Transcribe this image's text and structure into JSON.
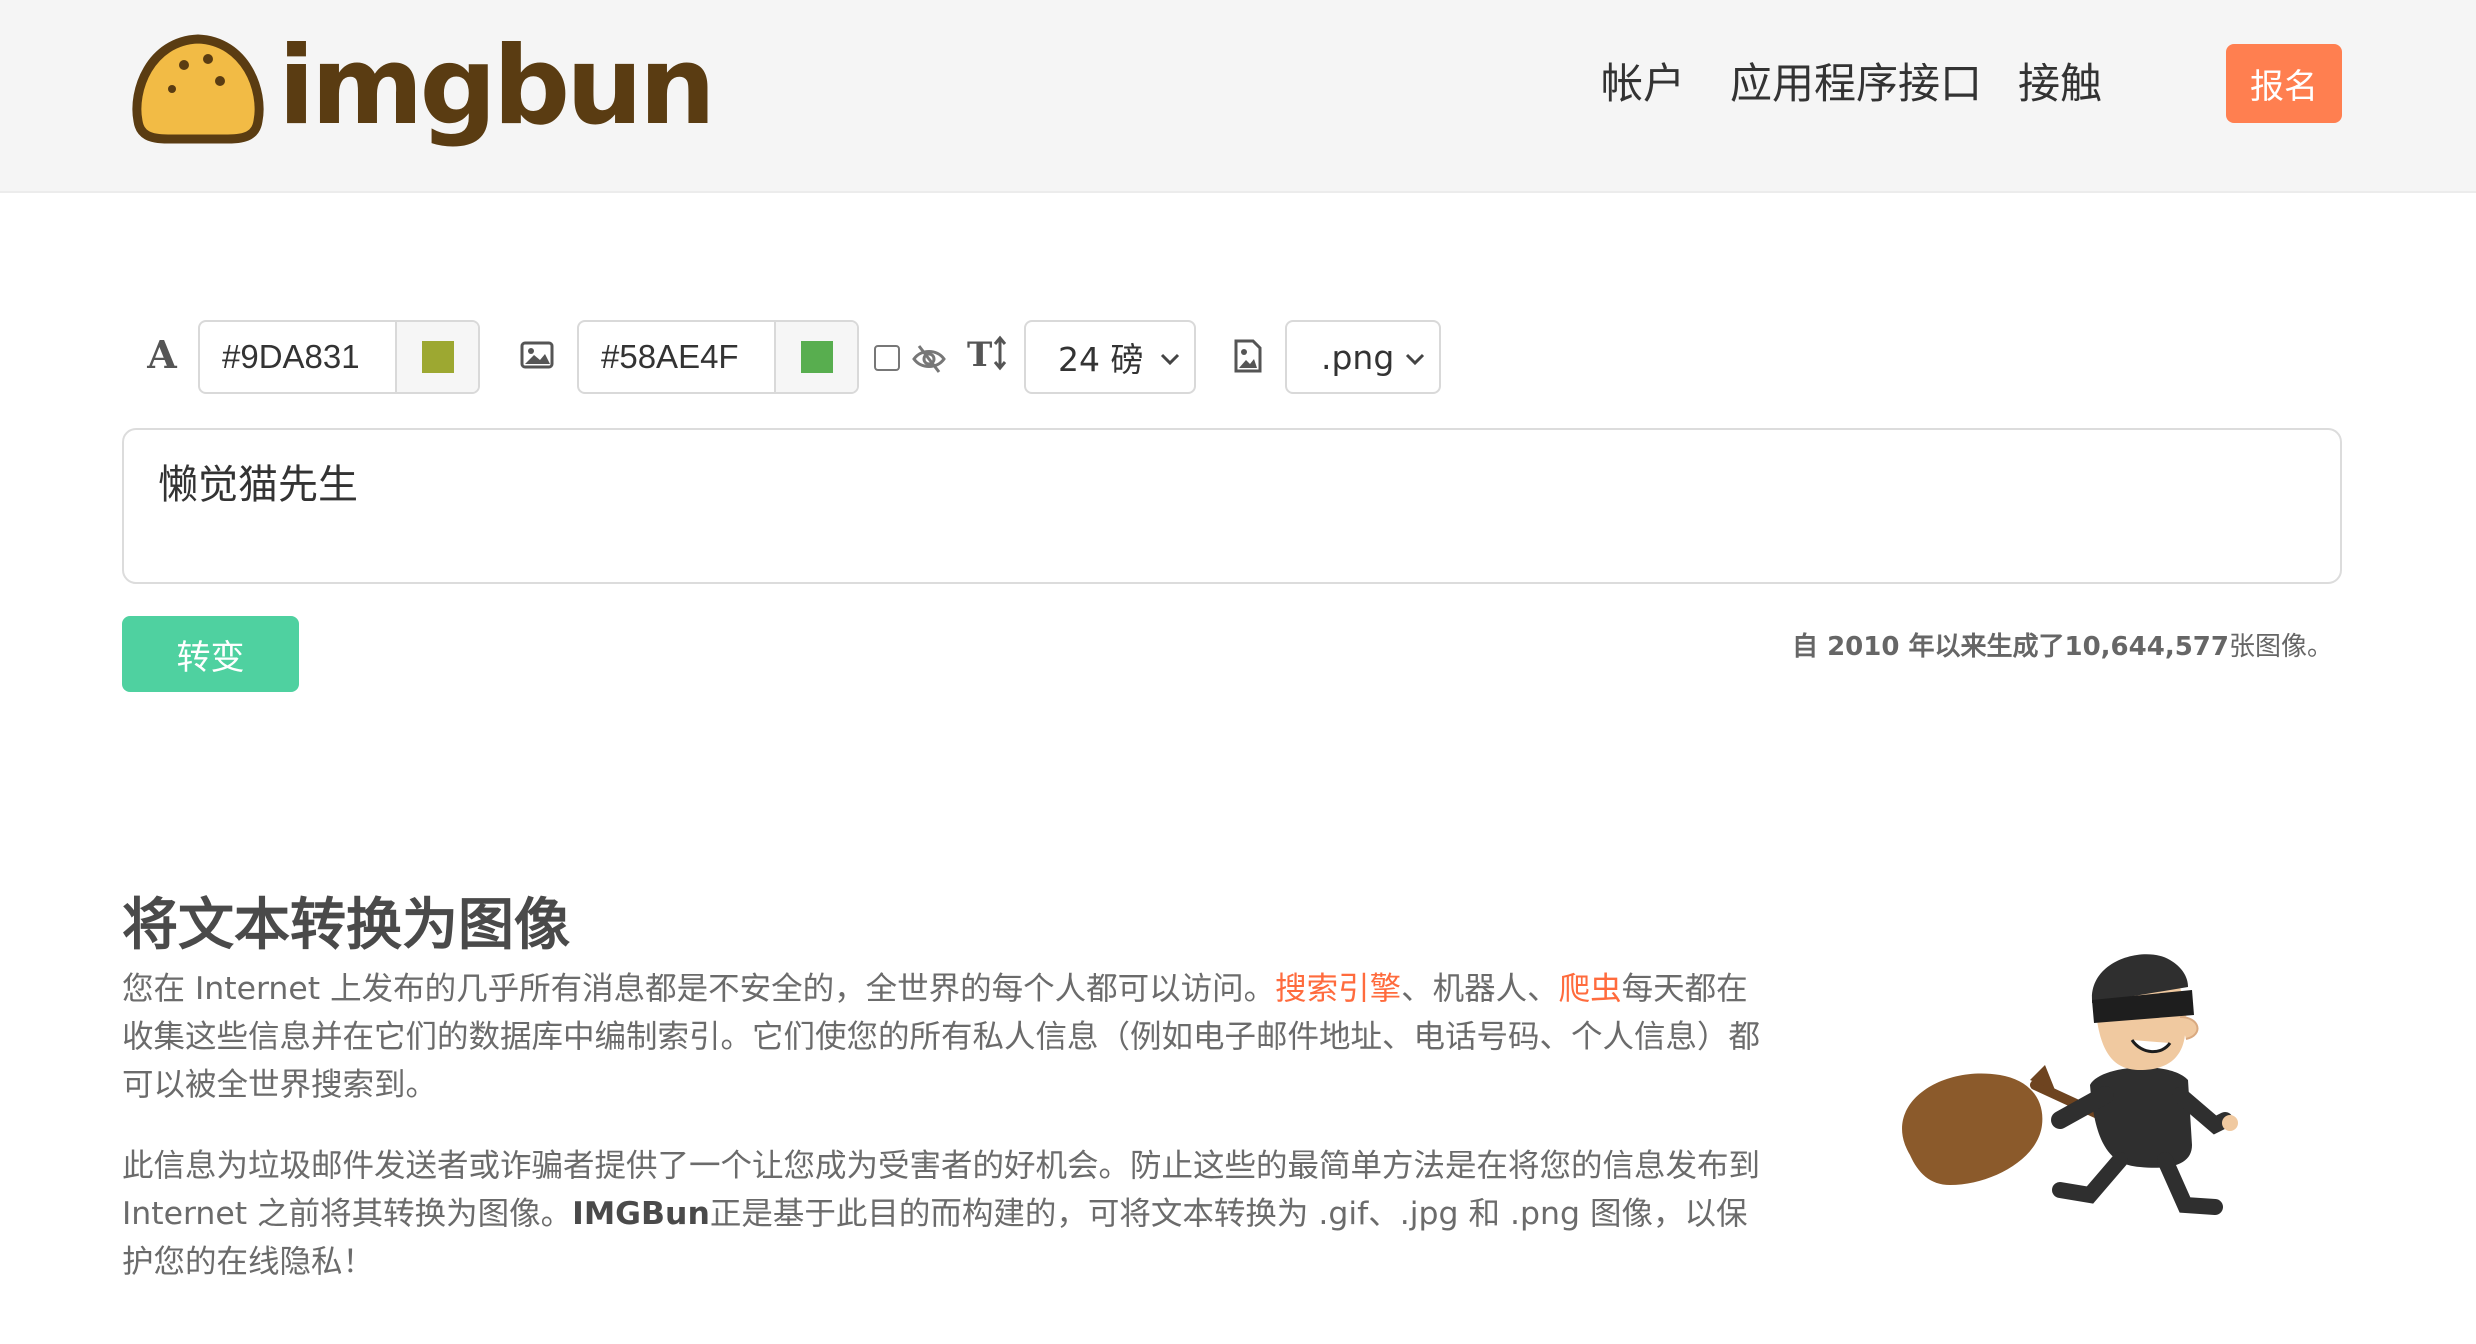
{
  "brand": {
    "name": "imgbun"
  },
  "nav": {
    "account": "帐户",
    "api": "应用程序接口",
    "contact": "接触",
    "signup": "报名"
  },
  "toolbar": {
    "text_color": "#9DA831",
    "text_swatch": "#9DA831",
    "bg_color": "#58AE4F",
    "bg_swatch": "#58AE4F",
    "font_size": "24 磅",
    "format": ".png"
  },
  "editor": {
    "text": "懒觉猫先生"
  },
  "actions": {
    "convert": "转变"
  },
  "stats": {
    "prefix": "自 2010 年以来生成了",
    "count": "10,644,577",
    "suffix": "张图像。"
  },
  "content": {
    "heading": "将文本转换为图像",
    "p1_a": "您在 Internet 上发布的几乎所有消息都是不安全的，全世界的每个人都可以访问。",
    "p1_link1": "搜索引擎",
    "p1_b": "、机器人、",
    "p1_link2": "爬虫",
    "p1_c": "每天都在收集这些信息并在它们的数据库中编制索引。它们使您的所有私人信息（例如电子邮件地址、电话号码、个人信息）都可以被全世界搜索到。",
    "p2_a": "此信息为垃圾邮件发送者或诈骗者提供了一个让您成为受害者的好机会。防止这些的最简单方法是在将您的信息发布到 Internet 之前将其转换为图像。",
    "p2_brand": "IMGBun",
    "p2_b": "正是基于此目的而构建的，可将文本转换为 .gif、.jpg 和 .png 图像，以保护您的在线隐私！"
  },
  "colors": {
    "accent": "#ff7f50",
    "button": "#4fd1a0",
    "link": "#ff6b3d",
    "bun": "#f2bb45",
    "brand_text": "#5a3c12"
  }
}
